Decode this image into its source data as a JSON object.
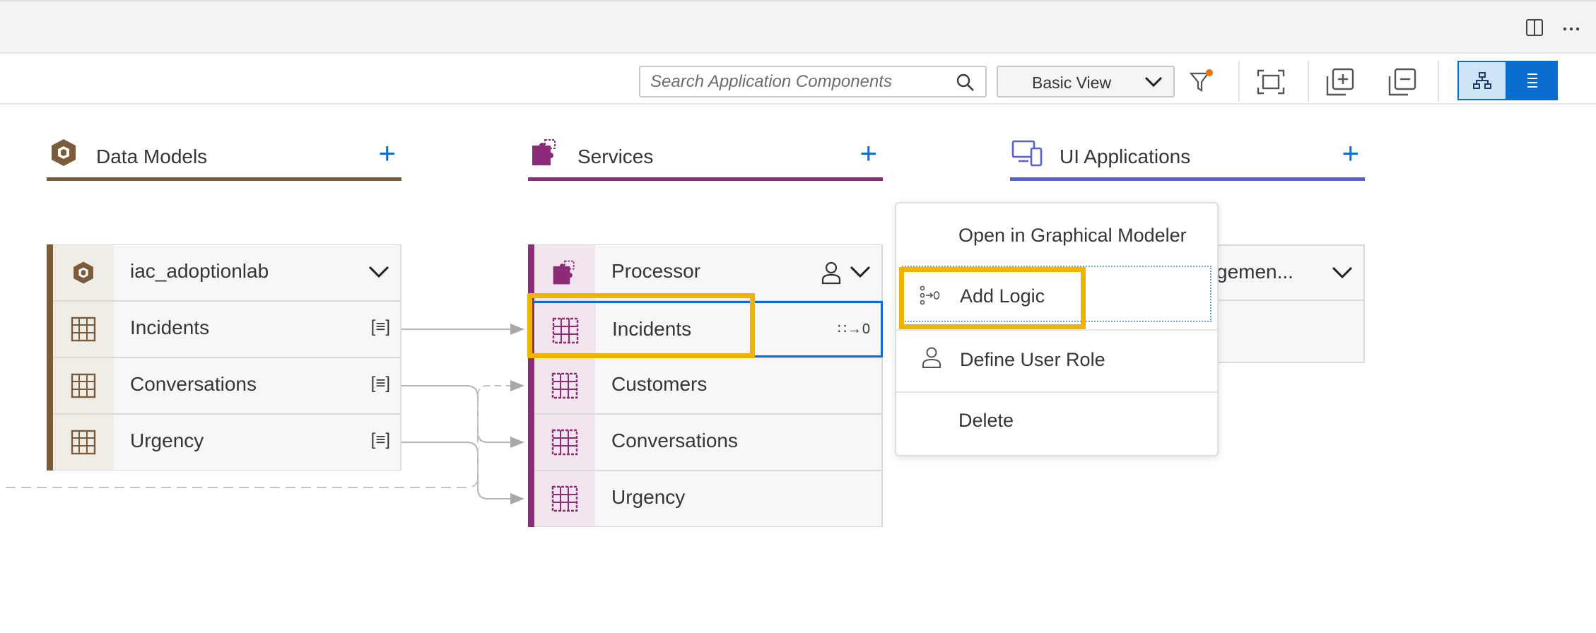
{
  "toolbar": {
    "search_placeholder": "Search Application Components",
    "view_select": "Basic View"
  },
  "columns": {
    "data_models": {
      "title": "Data Models",
      "color": "#7a5b3a"
    },
    "services": {
      "title": "Services",
      "color": "#8c2c78"
    },
    "ui_apps": {
      "title": "UI Applications",
      "color": "#5a5fd6"
    }
  },
  "data_models": {
    "header": "iac_adoptionlab",
    "entities": [
      {
        "name": "Incidents",
        "badge": "[≡]"
      },
      {
        "name": "Conversations",
        "badge": "[≡]"
      },
      {
        "name": "Urgency",
        "badge": "[≡]"
      }
    ]
  },
  "services": {
    "header": "Processor",
    "entities": [
      {
        "name": "Incidents",
        "badge": "∷→0"
      },
      {
        "name": "Customers"
      },
      {
        "name": "Conversations"
      },
      {
        "name": "Urgency"
      }
    ]
  },
  "ui_app": {
    "header_partial": "gemen..."
  },
  "context_menu": {
    "items": [
      {
        "label": "Open in Graphical Modeler"
      },
      {
        "label": "Add Logic",
        "icon": "add-logic-icon"
      },
      {
        "label": "Define User Role",
        "icon": "person-icon"
      },
      {
        "label": "Delete"
      }
    ]
  },
  "colors": {
    "accent_blue": "#0a6ed1",
    "highlight": "#f0b400"
  }
}
